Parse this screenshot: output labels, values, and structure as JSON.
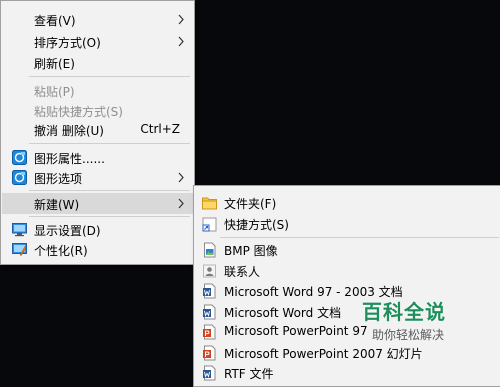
{
  "context_menu": {
    "items": [
      {
        "label": "查看(V)"
      },
      {
        "label": "排序方式(O)"
      },
      {
        "label": "刷新(E)"
      },
      {
        "label": "粘贴(P)"
      },
      {
        "label": "粘贴快捷方式(S)"
      },
      {
        "label": "撤消 删除(U)",
        "shortcut": "Ctrl+Z"
      },
      {
        "label": "图形属性......"
      },
      {
        "label": "图形选项"
      },
      {
        "label": "新建(W)"
      },
      {
        "label": "显示设置(D)"
      },
      {
        "label": "个性化(R)"
      }
    ]
  },
  "new_submenu": {
    "items": [
      {
        "label": "文件夹(F)",
        "icon": "folder-icon"
      },
      {
        "label": "快捷方式(S)",
        "icon": "shortcut-icon"
      },
      {
        "label": "BMP 图像",
        "icon": "bitmap-image-icon"
      },
      {
        "label": "联系人",
        "icon": "contact-icon"
      },
      {
        "label": "Microsoft Word 97 - 2003 文档",
        "icon": "word-doc-icon"
      },
      {
        "label": "Microsoft Word 文档",
        "icon": "word-doc-icon"
      },
      {
        "label": "Microsoft PowerPoint 97",
        "icon": "powerpoint-icon"
      },
      {
        "label": "Microsoft PowerPoint 2007 幻灯片",
        "icon": "powerpoint-icon"
      },
      {
        "label": "RTF 文件",
        "icon": "rtf-doc-icon"
      }
    ]
  },
  "watermark": {
    "title": "百科全说",
    "subtitle": "助你轻松解决"
  },
  "colors": {
    "menu_bg": "#f2f2f2",
    "hover_bg": "#d9d9d9",
    "desktop_bg": "#07080b",
    "watermark_green": "#1d8f5a"
  }
}
